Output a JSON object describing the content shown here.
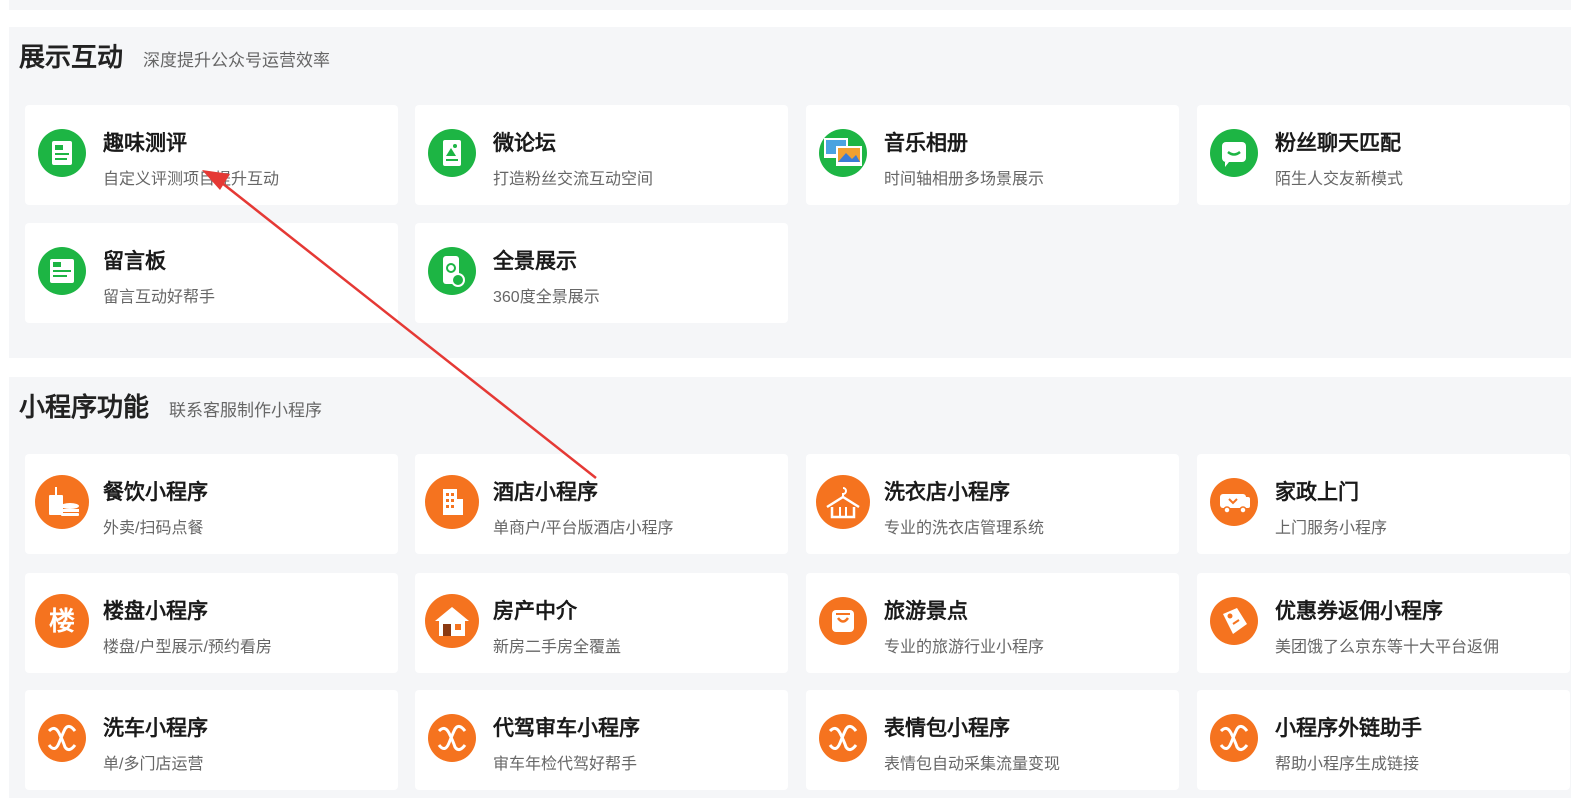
{
  "sections": [
    {
      "title": "展示互动",
      "subtitle": "深度提升公众号运营效率",
      "items": [
        {
          "title": "趣味测评",
          "desc": "自定义评测项目提升互动",
          "icon": "quiz-doc-icon",
          "color": "#1db544"
        },
        {
          "title": "微论坛",
          "desc": "打造粉丝交流互动空间",
          "icon": "forum-doc-icon",
          "color": "#1db544"
        },
        {
          "title": "音乐相册",
          "desc": "时间轴相册多场景展示",
          "icon": "photo-album-icon",
          "color": "#1db544"
        },
        {
          "title": "粉丝聊天匹配",
          "desc": "陌生人交友新模式",
          "icon": "chat-bubble-icon",
          "color": "#1db544"
        },
        {
          "title": "留言板",
          "desc": "留言互动好帮手",
          "icon": "message-board-icon",
          "color": "#1db544"
        },
        {
          "title": "全景展示",
          "desc": "360度全景展示",
          "icon": "panorama-phone-icon",
          "color": "#1db544"
        }
      ]
    },
    {
      "title": "小程序功能",
      "subtitle": "联系客服制作小程序",
      "items": [
        {
          "title": "餐饮小程序",
          "desc": "外卖/扫码点餐",
          "icon": "food-drink-icon",
          "color": "#f5731f"
        },
        {
          "title": "酒店小程序",
          "desc": "单商户/平台版酒店小程序",
          "icon": "hotel-building-icon",
          "color": "#f5731f"
        },
        {
          "title": "洗衣店小程序",
          "desc": "专业的洗衣店管理系统",
          "icon": "clothes-hanger-icon",
          "color": "#f5731f"
        },
        {
          "title": "家政上门",
          "desc": "上门服务小程序",
          "icon": "delivery-truck-icon",
          "color": "#f5731f"
        },
        {
          "title": "楼盘小程序",
          "desc": "楼盘/户型展示/预约看房",
          "icon": "building-char-icon",
          "icon_text": "楼",
          "color": "#f5731f"
        },
        {
          "title": "房产中介",
          "desc": "新房二手房全覆盖",
          "icon": "house-icon",
          "color": "#f5731f"
        },
        {
          "title": "旅游景点",
          "desc": "专业的旅游行业小程序",
          "icon": "shopping-bag-icon",
          "color": "#f5731f"
        },
        {
          "title": "优惠券返佣小程序",
          "desc": "美团饿了么京东等十大平台返佣",
          "icon": "coupon-tag-icon",
          "color": "#f5731f"
        },
        {
          "title": "洗车小程序",
          "desc": "单/多门店运营",
          "icon": "miniprogram-logo-icon",
          "color": "#f5731f"
        },
        {
          "title": "代驾审车小程序",
          "desc": "审车年检代驾好帮手",
          "icon": "miniprogram-logo-icon",
          "color": "#f5731f"
        },
        {
          "title": "表情包小程序",
          "desc": "表情包自动采集流量变现",
          "icon": "miniprogram-logo-icon",
          "color": "#f5731f"
        },
        {
          "title": "小程序外链助手",
          "desc": "帮助小程序生成链接",
          "icon": "miniprogram-logo-icon",
          "color": "#f5731f"
        }
      ]
    }
  ],
  "annotation": {
    "color": "#e53935"
  }
}
